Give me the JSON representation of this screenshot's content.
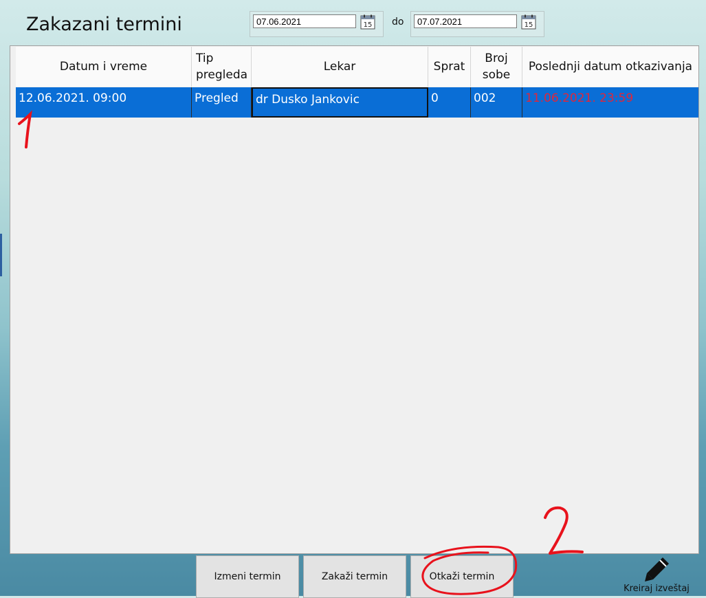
{
  "page": {
    "title": "Zakazani termini"
  },
  "date_range": {
    "from": "07.06.2021",
    "separator": "do",
    "to": "07.07.2021",
    "calendar_icon_text": "15"
  },
  "table": {
    "headers": {
      "datum": "Datum i vreme",
      "tip_line1": "Tip",
      "tip_line2": "pregleda",
      "lekar": "Lekar",
      "sprat": "Sprat",
      "soba_line1": "Broj",
      "soba_line2": "sobe",
      "otkaz": "Poslednji datum otkazivanja"
    },
    "rows": [
      {
        "datum": "12.06.2021. 09:00",
        "tip": "Pregled",
        "lekar": "dr Dusko Jankovic",
        "sprat": "0",
        "soba": "002",
        "otkaz": "11.06.2021. 23:59"
      }
    ]
  },
  "buttons": {
    "izmeni": "Izmeni termin",
    "zakazi": "Zakaži termin",
    "otkazi": "Otkaži termin",
    "report": "Kreiraj izveštaj"
  },
  "annotations": {
    "one": "1",
    "two": "2"
  },
  "colors": {
    "selection": "#0a6ed6",
    "deadline": "#e0263a",
    "annotation": "#e8121c"
  }
}
